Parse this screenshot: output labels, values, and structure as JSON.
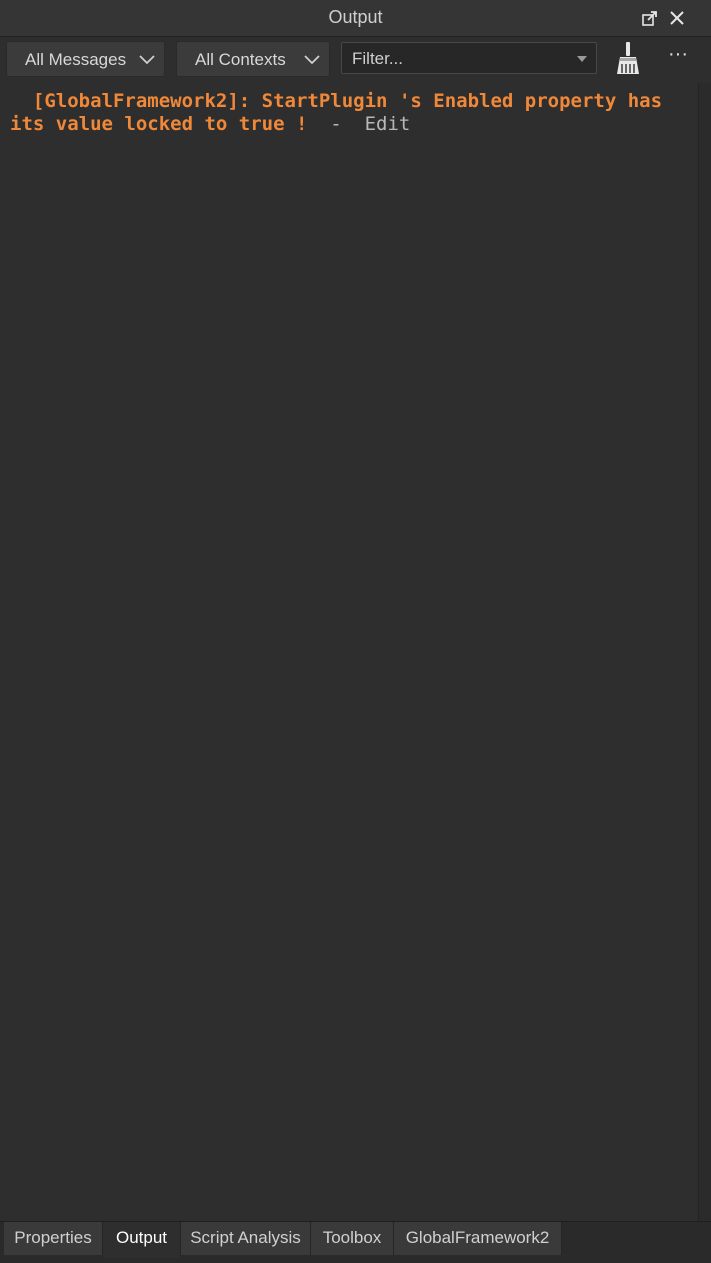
{
  "window": {
    "title": "Output"
  },
  "toolbar": {
    "messages_filter": "All Messages",
    "contexts_filter": "All Contexts",
    "filter_placeholder": "Filter...",
    "more_label": "···"
  },
  "messages": [
    {
      "text": "  [GlobalFramework2]: StartPlugin 's Enabled property has its value locked to true ! ",
      "context": " -  Edit",
      "color": "#f0883a"
    }
  ],
  "tabs": [
    {
      "label": "Properties",
      "active": false
    },
    {
      "label": "Output",
      "active": true
    },
    {
      "label": "Script Analysis",
      "active": false
    },
    {
      "label": "Toolbox",
      "active": false
    },
    {
      "label": "GlobalFramework2",
      "active": false
    }
  ],
  "icons": {
    "undock": "undock-icon",
    "close": "close-icon",
    "chevron": "chevron-down-icon",
    "clear": "broom-icon",
    "more": "more-icon"
  }
}
